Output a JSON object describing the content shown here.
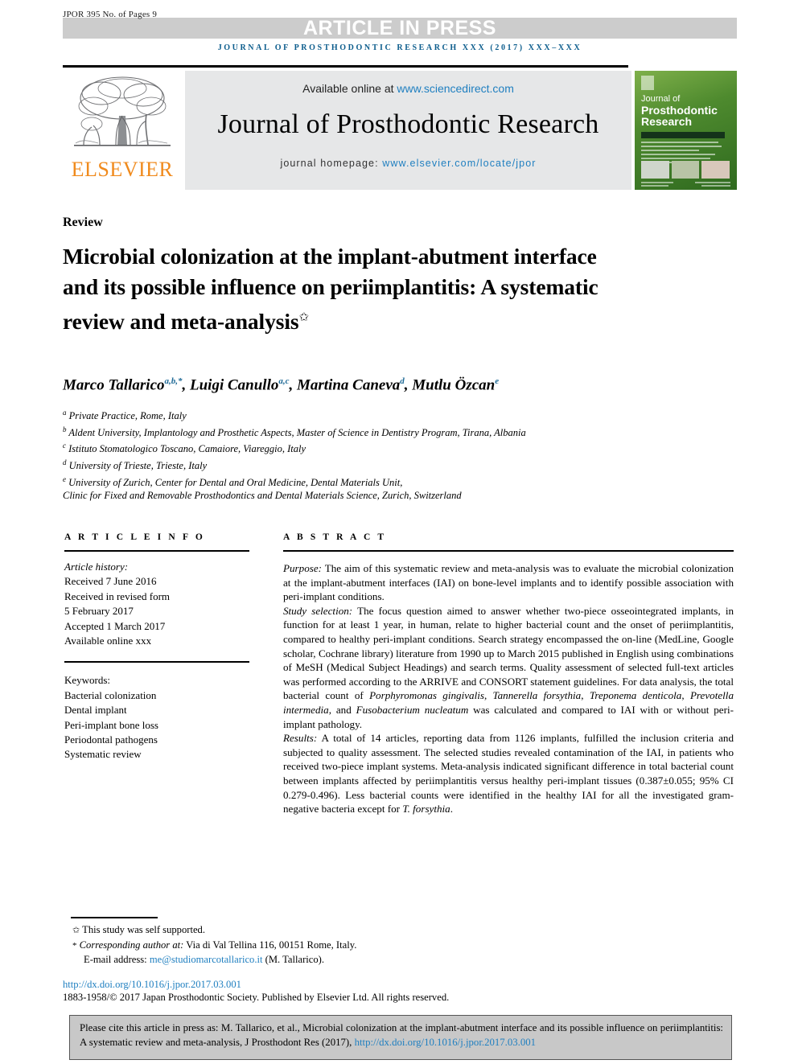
{
  "running_head": "JPOR 395 No. of Pages 9",
  "banner_text": "ARTICLE IN PRESS",
  "journal_line": "JOURNAL OF PROSTHODONTIC RESEARCH XXX (2017) XXX–XXX",
  "masthead": {
    "available_prefix": "Available online at ",
    "sciencedirect_url": "www.sciencedirect.com",
    "journal_title": "Journal of Prosthodontic Research",
    "homepage_label": "journal homepage: ",
    "homepage_url": "www.elsevier.com/locate/jpor",
    "publisher": "ELSEVIER",
    "cover": {
      "line1": "Journal of",
      "line2": "Prosthodontic",
      "line3": "Research"
    }
  },
  "article": {
    "section": "Review",
    "title": "Microbial colonization at the implant-abutment interface and its possible influence on periimplantitis: A systematic review and meta-analysis",
    "title_marker": "✩",
    "authors_html": "Marco Tallarico, Luigi Canullo, Martina Caneva, Mutlu Özcan",
    "authors": [
      {
        "name": "Marco Tallarico",
        "marks": "a,b,*"
      },
      {
        "name": "Luigi Canullo",
        "marks": "a,c"
      },
      {
        "name": "Martina Caneva",
        "marks": "d"
      },
      {
        "name": "Mutlu Özcan",
        "marks": "e"
      }
    ],
    "affiliations": [
      {
        "mark": "a",
        "text": "Private Practice, Rome, Italy"
      },
      {
        "mark": "b",
        "text": "Aldent University, Implantology and Prosthetic Aspects, Master of Science in Dentistry Program, Tirana, Albania"
      },
      {
        "mark": "c",
        "text": "Istituto Stomatologico Toscano, Camaiore, Viareggio, Italy"
      },
      {
        "mark": "d",
        "text": "University of Trieste, Trieste, Italy"
      },
      {
        "mark": "e",
        "text": "University of Zurich, Center for Dental and Oral Medicine, Dental Materials Unit,"
      },
      {
        "mark": "",
        "text": "Clinic for Fixed and Removable Prosthodontics and Dental Materials Science, Zurich, Switzerland"
      }
    ]
  },
  "article_info": {
    "heading": "A R T I C L E   I N F O",
    "history_label": "Article history:",
    "history": [
      "Received 7 June 2016",
      "Received in revised form",
      "5 February 2017",
      "Accepted 1 March 2017",
      "Available online xxx"
    ],
    "keywords_label": "Keywords:",
    "keywords": [
      "Bacterial colonization",
      "Dental implant",
      "Peri-implant bone loss",
      "Periodontal pathogens",
      "Systematic review"
    ]
  },
  "abstract": {
    "heading": "A B S T R A C T",
    "purpose_label": "Purpose:",
    "purpose_text": " The aim of this systematic review and meta-analysis was to evaluate the microbial colonization at the implant-abutment interfaces (IAI) on bone-level implants and to identify possible association with peri-implant conditions.",
    "study_label": "Study selection:",
    "study_text_1": " The focus question aimed to answer whether two-piece osseointegrated implants, in function for at least 1 year, in human, relate to higher bacterial count and the onset of periimplantitis, compared to healthy peri-implant conditions. Search strategy encompassed the on-line (MedLine, Google scholar, Cochrane library) literature from 1990 up to March 2015 published in English using combinations of MeSH (Medical Subject Headings) and search terms. Quality assessment of selected full-text articles was performed according to the ARRIVE and CONSORT statement guidelines. For data analysis, the total bacterial count of ",
    "sp1": "Porphyromonas gingivalis",
    "study_sep1": ", ",
    "sp2": "Tannerella forsythia",
    "study_sep2": ", ",
    "sp3": "Treponema denticola",
    "study_sep3": ", ",
    "sp4": "Prevotella intermedia",
    "study_sep4": ", and ",
    "sp5": "Fusobacterium nucleatum",
    "study_text_2": " was calculated and compared to IAI with or without peri-implant pathology.",
    "results_label": "Results:",
    "results_text": " A total of 14 articles, reporting data from 1126 implants, fulfilled the inclusion criteria and subjected to quality assessment. The selected studies revealed contamination of the IAI, in patients who received two-piece implant systems. Meta-analysis indicated significant difference in total bacterial count between implants affected by periimplantitis versus healthy peri-implant tissues (0.387±0.055; 95% CI 0.279-0.496). Less bacterial counts were identified in the healthy IAI for all the investigated gram-negative bacteria except for ",
    "results_sp": "T. forsythia",
    "results_tail": "."
  },
  "footnotes": {
    "fn1_mark": "✩",
    "fn1_text": "This study was self supported.",
    "fn2_mark": "*",
    "fn2_italic": "Corresponding author at:",
    "fn2_text": " Via di Val Tellina 116, 00151 Rome, Italy.",
    "email_label": "E-mail address: ",
    "email": "me@studiomarcotallarico.it",
    "email_tail": " (M. Tallarico).",
    "doi": "http://dx.doi.org/10.1016/j.jpor.2017.03.001",
    "copyright": "1883-1958/© 2017 Japan Prosthodontic Society. Published by Elsevier Ltd. All rights reserved."
  },
  "cite_box": {
    "text": "Please cite this article in press as: M. Tallarico, et al., Microbial colonization at the implant-abutment interface and its possible influence on periimplantitis: A systematic review and meta-analysis, J Prosthodont Res (2017), ",
    "link": "http://dx.doi.org/10.1016/j.jpor.2017.03.001"
  },
  "colors": {
    "journal_blue": "#0b5c8c",
    "link_blue": "#1f7fc0",
    "elsevier_orange": "#f08a1c",
    "banner_gray": "#cccccc",
    "masthead_gray": "#e6e7e8",
    "cover_green": "#4e8a2e"
  }
}
